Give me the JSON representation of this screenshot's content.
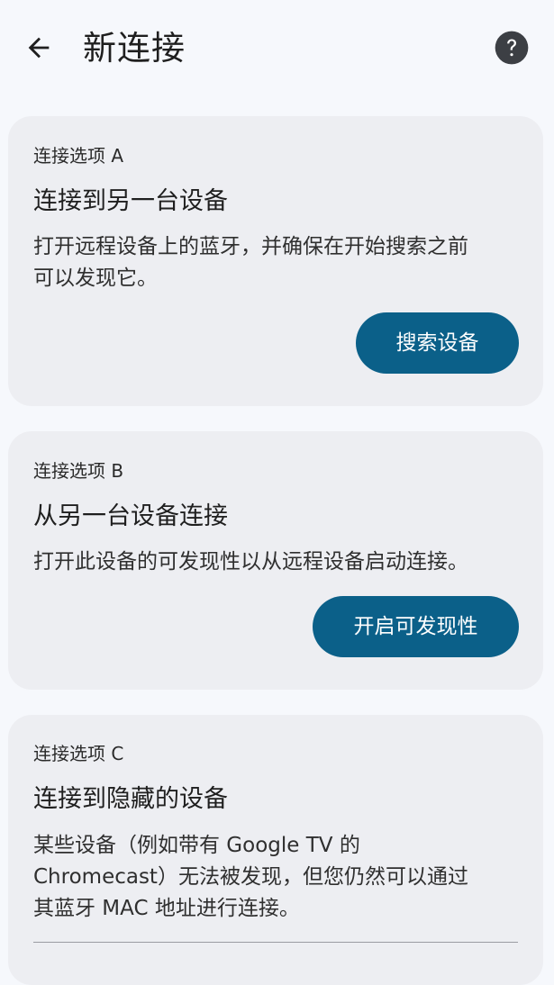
{
  "header": {
    "title": "新连接",
    "back_icon": "arrow-left-icon",
    "help_icon": "help-circle-icon"
  },
  "cards": [
    {
      "label": "连接选项 A",
      "title": "连接到另一台设备",
      "description_lines": [
        "打开远程设备上的蓝牙，并确保在开始搜索之前",
        "可以发现它。"
      ],
      "button": "搜索设备"
    },
    {
      "label": "连接选项 B",
      "title": "从另一台设备连接",
      "description_lines": [
        "打开此设备的可发现性以从远程设备启动连接。"
      ],
      "button": "开启可发现性"
    },
    {
      "label": "连接选项 C",
      "title": "连接到隐藏的设备",
      "description_lines": [
        "某些设备（例如带有 Google TV 的",
        "Chromecast）无法被发现，但您仍然可以通过",
        "其蓝牙 MAC 地址进行连接。"
      ]
    }
  ],
  "colors": {
    "background": "#f6f8fc",
    "card": "#edeef2",
    "accent_button": "#0b6089",
    "text_primary": "#1f1f1f"
  }
}
